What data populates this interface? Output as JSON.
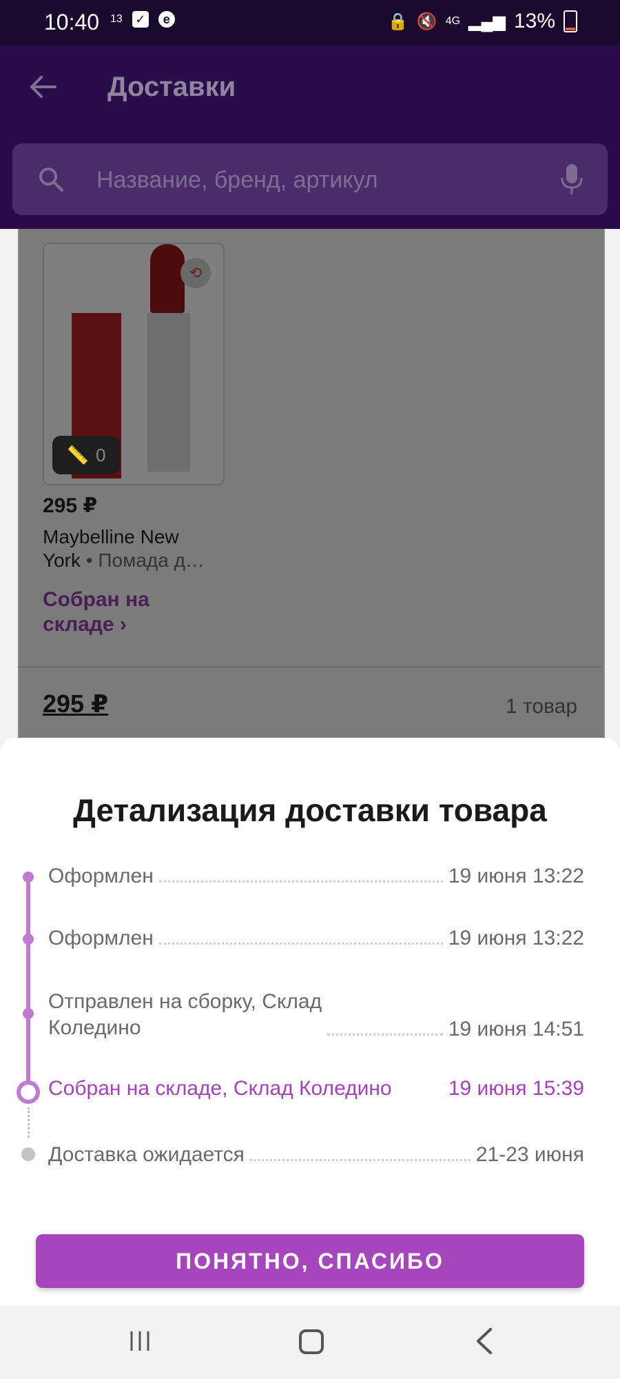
{
  "status_bar": {
    "time": "10:40",
    "left_badge": "13",
    "left_icon_e": "e",
    "network": "4G",
    "battery": "13%"
  },
  "header": {
    "title": "Доставки",
    "search_placeholder": "Название, бренд, артикул"
  },
  "product": {
    "price": "295 ₽",
    "ruler_count": "0",
    "brand": "Maybelline New York",
    "name_short": "• Помада д…",
    "status_link": "Собран на складе ›"
  },
  "summary": {
    "total": "295 ₽",
    "count": "1 товар"
  },
  "sheet": {
    "title": "Детализация доставки товара",
    "events": [
      {
        "label": "Оформлен",
        "time": "19 июня 13:22"
      },
      {
        "label": "Оформлен",
        "time": "19 июня 13:22"
      },
      {
        "label": "Отправлен на сборку, Склад Коледино",
        "label_line1": "Отправлен на сборку, Склад",
        "label_line2": "Коледино",
        "time": "19 июня 14:51"
      },
      {
        "label": "Собран на складе, Склад Коледино",
        "time": "19 июня 15:39",
        "state": "current"
      },
      {
        "label": "Доставка ожидается",
        "time": "21-23 июня",
        "state": "pending"
      }
    ],
    "button_label": "ПОНЯТНО, СПАСИБО"
  },
  "colors": {
    "accent": "#a546bc",
    "timeline": "#c27ad0",
    "appbar": "#2a0c4a"
  }
}
